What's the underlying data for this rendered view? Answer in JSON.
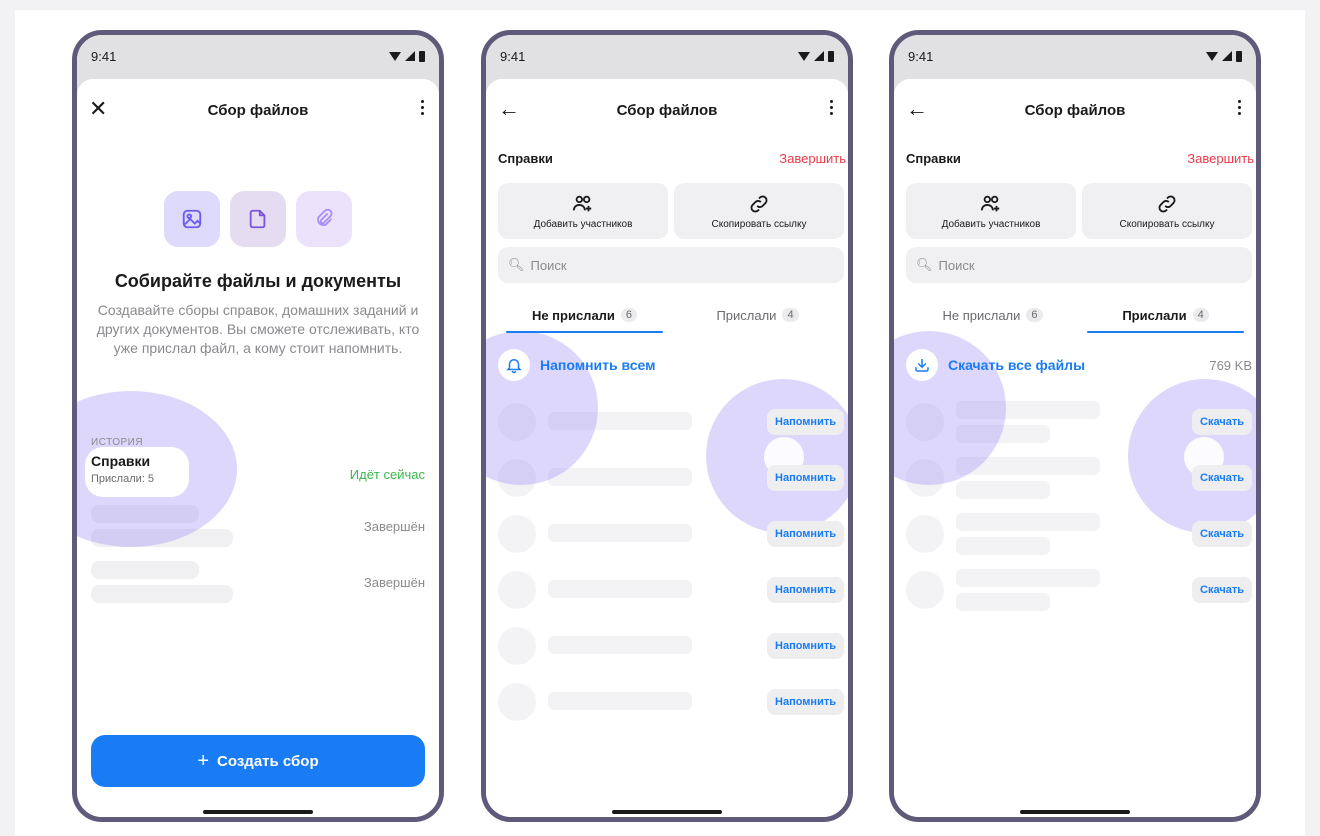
{
  "status_time": "9:41",
  "screens": {
    "start": {
      "title": "Сбор файлов",
      "promo_title": "Собирайте файлы и документы",
      "promo_text": "Создавайте сборы справок, домашних заданий и других документов. Вы сможете отслеживать, кто уже прислал файл, а кому стоит напомнить.",
      "history_label": "ИСТОРИЯ",
      "history": [
        {
          "title": "Справки",
          "subtitle": "Прислали: 5",
          "status": "Идёт сейчас"
        },
        {
          "title": "",
          "subtitle": "",
          "status": "Завершён"
        },
        {
          "title": "",
          "subtitle": "",
          "status": "Завершён"
        }
      ],
      "create_label": "Создать сбор"
    },
    "not_sent": {
      "title": "Сбор файлов",
      "section": "Справки",
      "finish": "Завершить",
      "add_members": "Добавить участников",
      "copy_link": "Скопировать ссылку",
      "search_placeholder": "Поиск",
      "tab_not_sent": "Не прислали",
      "tab_not_sent_count": "6",
      "tab_sent": "Прислали",
      "tab_sent_count": "4",
      "bulk_label": "Напомнить всем",
      "row_action": "Напомнить"
    },
    "sent": {
      "title": "Сбор файлов",
      "section": "Справки",
      "finish": "Завершить",
      "add_members": "Добавить участников",
      "copy_link": "Скопировать ссылку",
      "search_placeholder": "Поиск",
      "tab_not_sent": "Не прислали",
      "tab_not_sent_count": "6",
      "tab_sent": "Прислали",
      "tab_sent_count": "4",
      "bulk_label": "Скачать все файлы",
      "bulk_size": "769 KB",
      "row_action": "Скачать"
    }
  },
  "colors": {
    "accent": "#1a7cf4",
    "danger": "#ed3b4b",
    "success": "#3ab64a",
    "highlight": "#9682f5"
  }
}
